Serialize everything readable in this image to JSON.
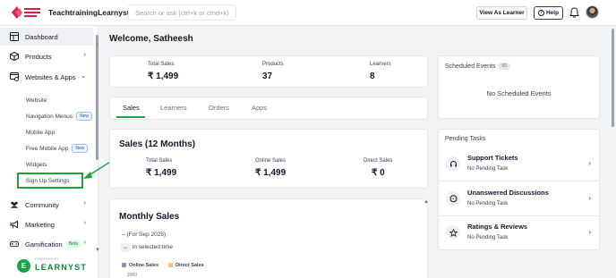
{
  "header": {
    "logo_alt": "Teach Employee Support",
    "brand": "TeachtrainingLearnyst",
    "search_placeholder": "Search or ask (ctrl+k or cmd+k)",
    "view_as_learner": "View As Learner",
    "help": "Help"
  },
  "sidebar": {
    "items": [
      {
        "label": "Dashboard",
        "icon": "dashboard-icon"
      },
      {
        "label": "Products",
        "icon": "box-icon"
      },
      {
        "label": "Websites & Apps",
        "icon": "website-icon"
      },
      {
        "label": "Community",
        "icon": "community-icon"
      },
      {
        "label": "Marketing",
        "icon": "megaphone-icon"
      },
      {
        "label": "Gamification",
        "icon": "gamepad-icon",
        "badge": "Beta"
      }
    ],
    "sub_items": [
      {
        "label": "Website"
      },
      {
        "label": "Navigation Menus",
        "badge": "New"
      },
      {
        "label": "Mobile App"
      },
      {
        "label": "Free Mobile App",
        "badge": "New"
      },
      {
        "label": "Widgets"
      },
      {
        "label": "Sign Up Settings"
      }
    ],
    "powered_by": "POWERED BY",
    "powered_brand": "LEARNYST"
  },
  "main": {
    "welcome": "Welcome, Satheesh",
    "stats": [
      {
        "label": "Total Sales",
        "value": "₹ 1,499"
      },
      {
        "label": "Products",
        "value": "37"
      },
      {
        "label": "Learners",
        "value": "8"
      }
    ],
    "tabs": [
      "Sales",
      "Learners",
      "Orders",
      "Apps"
    ],
    "active_tab": "Sales",
    "sales_title": "Sales (12 Months)",
    "sales_stats": [
      {
        "label": "Total Sales",
        "value": "₹ 1,499"
      },
      {
        "label": "Online Sales",
        "value": "₹ 1,499"
      },
      {
        "label": "Direct Sales",
        "value": "₹ 0"
      }
    ],
    "monthly_title": "Monthly Sales",
    "monthly_period_dash": "–",
    "monthly_period": "(For Sep 2025)",
    "monthly_arrows": "↔",
    "monthly_selected": "in selected time",
    "legend": [
      {
        "name": "Online Sales",
        "color": "#8b93b5"
      },
      {
        "name": "Direct Sales",
        "color": "#f5c86a"
      }
    ],
    "y_tick": "2000"
  },
  "right": {
    "scheduled_title": "Scheduled Events",
    "scheduled_count": "00",
    "no_events": "No Scheduled Events",
    "pending_title": "Pending Tasks",
    "pending": [
      {
        "title": "Support Tickets",
        "sub": "No Pending Task",
        "icon": "headset-icon"
      },
      {
        "title": "Unanswered Discussions",
        "sub": "No Pending Task",
        "icon": "chat-icon"
      },
      {
        "title": "Ratings & Reviews",
        "sub": "No Pending Task",
        "icon": "star-icon"
      }
    ]
  },
  "colors": {
    "accent": "#16a34a",
    "highlight": "#22a33a",
    "brand_red": "#d9223b"
  }
}
